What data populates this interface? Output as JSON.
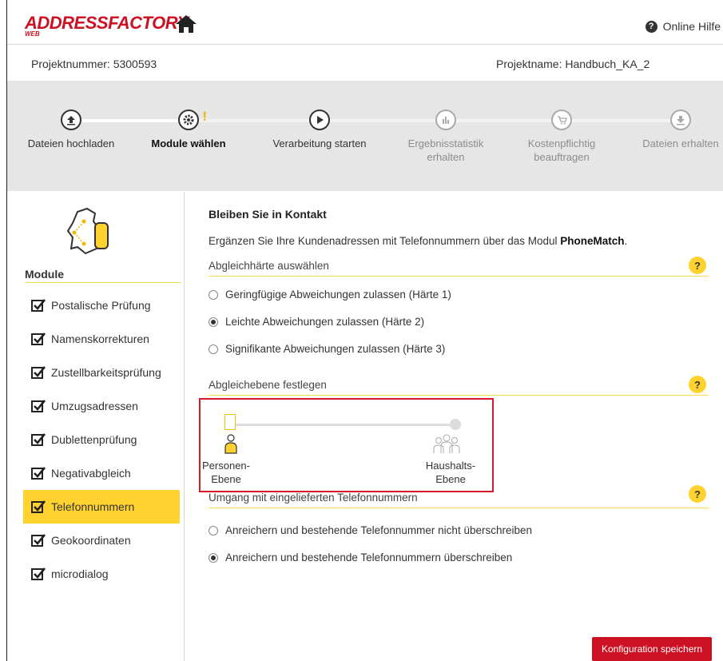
{
  "header": {
    "logo_text": "ADDRESSFACTORY",
    "logo_sub": "WEB",
    "help_label": "Online Hilfe",
    "help_icon_glyph": "?"
  },
  "project": {
    "number_label": "Projektnummer: 5300593",
    "name_label": "Projektname: Handbuch_KA_2"
  },
  "steps": [
    {
      "label": "Dateien hochladen",
      "icon": "upload-icon",
      "state": "done"
    },
    {
      "label": "Module wählen",
      "icon": "gear-icon",
      "state": "active",
      "warning": "!"
    },
    {
      "label": "Verarbeitung starten",
      "icon": "play-icon",
      "state": "normal"
    },
    {
      "label": "Ergebnisstatistik erhalten",
      "icon": "chart-icon",
      "state": "disabled"
    },
    {
      "label": "Kostenpflichtig beauftragen",
      "icon": "cart-icon",
      "state": "disabled"
    },
    {
      "label": "Dateien erhalten",
      "icon": "download-icon",
      "state": "disabled"
    }
  ],
  "sidebar": {
    "title": "Module",
    "items": [
      {
        "label": "Postalische Prüfung",
        "checked": true
      },
      {
        "label": "Namenskorrekturen",
        "checked": true
      },
      {
        "label": "Zustellbarkeitsprüfung",
        "checked": true
      },
      {
        "label": "Umzugsadressen",
        "checked": true
      },
      {
        "label": "Dublettenprüfung",
        "checked": true
      },
      {
        "label": "Negativabgleich",
        "checked": true
      },
      {
        "label": "Telefonnummern",
        "checked": true,
        "active": true
      },
      {
        "label": "Geokoordinaten",
        "checked": true
      },
      {
        "label": "microdialog",
        "checked": true
      }
    ]
  },
  "main": {
    "title": "Bleiben Sie in Kontakt",
    "desc_prefix": "Ergänzen Sie Ihre Kundenadressen mit Telefonnummern über das Modul ",
    "desc_bold": "PhoneMatch",
    "desc_suffix": ".",
    "help_glyph": "?",
    "section1": {
      "label": "Abgleichhärte auswählen",
      "options": [
        {
          "label": "Geringfügige Abweichungen zulassen (Härte 1)",
          "checked": false
        },
        {
          "label": "Leichte Abweichungen zulassen (Härte 2)",
          "checked": true
        },
        {
          "label": "Signifikante Abweichungen zulassen (Härte 3)",
          "checked": false
        }
      ]
    },
    "section2": {
      "label": "Abgleichebene festlegen",
      "left_label_1": "Personen-",
      "left_label_2": "Ebene",
      "right_label_1": "Haushalts-",
      "right_label_2": "Ebene",
      "slider_value": "Personen-Ebene"
    },
    "section3": {
      "label": "Umgang mit eingelieferten Telefonnummern",
      "options": [
        {
          "label": "Anreichern und bestehende Telefonnummer nicht überschreiben",
          "checked": false
        },
        {
          "label": "Anreichern und bestehende Telefonnummern überschreiben",
          "checked": true
        }
      ]
    },
    "save_label": "Konfiguration speichern"
  },
  "colors": {
    "brand_red": "#cc1123",
    "accent_yellow": "#ffd230",
    "highlight_red": "#d61928"
  }
}
